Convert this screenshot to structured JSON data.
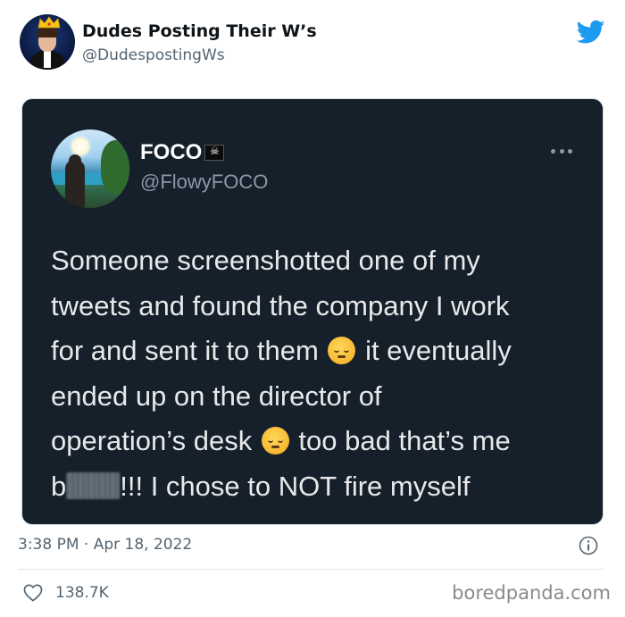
{
  "outer_tweet": {
    "author_name": "Dudes Posting Their W’s",
    "author_handle": "@DudespostingWs",
    "avatar_icon": "avatar-man-with-crown",
    "platform_icon": "twitter-bird-icon",
    "brand_color": "#1d9bf0",
    "timestamp": "3:38 PM · Apr 18, 2022",
    "like_count": "138.7K"
  },
  "screenshot": {
    "theme_background": "#15202b",
    "author_name": "FOCO",
    "author_flag": "☠",
    "author_handle": "@FlowyFOCO",
    "avatar_icon": "avatar-beach-photo",
    "lines": [
      {
        "parts": [
          "Someone screenshotted one of my"
        ]
      },
      {
        "parts": [
          "tweets and found the company I work"
        ]
      },
      {
        "before": "for and sent it to them ",
        "emoji": "pensive-face-emoji",
        "after": " it eventually"
      },
      {
        "parts": [
          "ended up on the director of"
        ]
      },
      {
        "before": "operation’s desk ",
        "emoji": "pensive-face-emoji",
        "after": " too bad that’s me"
      },
      {
        "before": "b",
        "censored": true,
        "after": "!!! I chose to NOT fire myself"
      }
    ]
  },
  "watermark": "boredpanda.com"
}
